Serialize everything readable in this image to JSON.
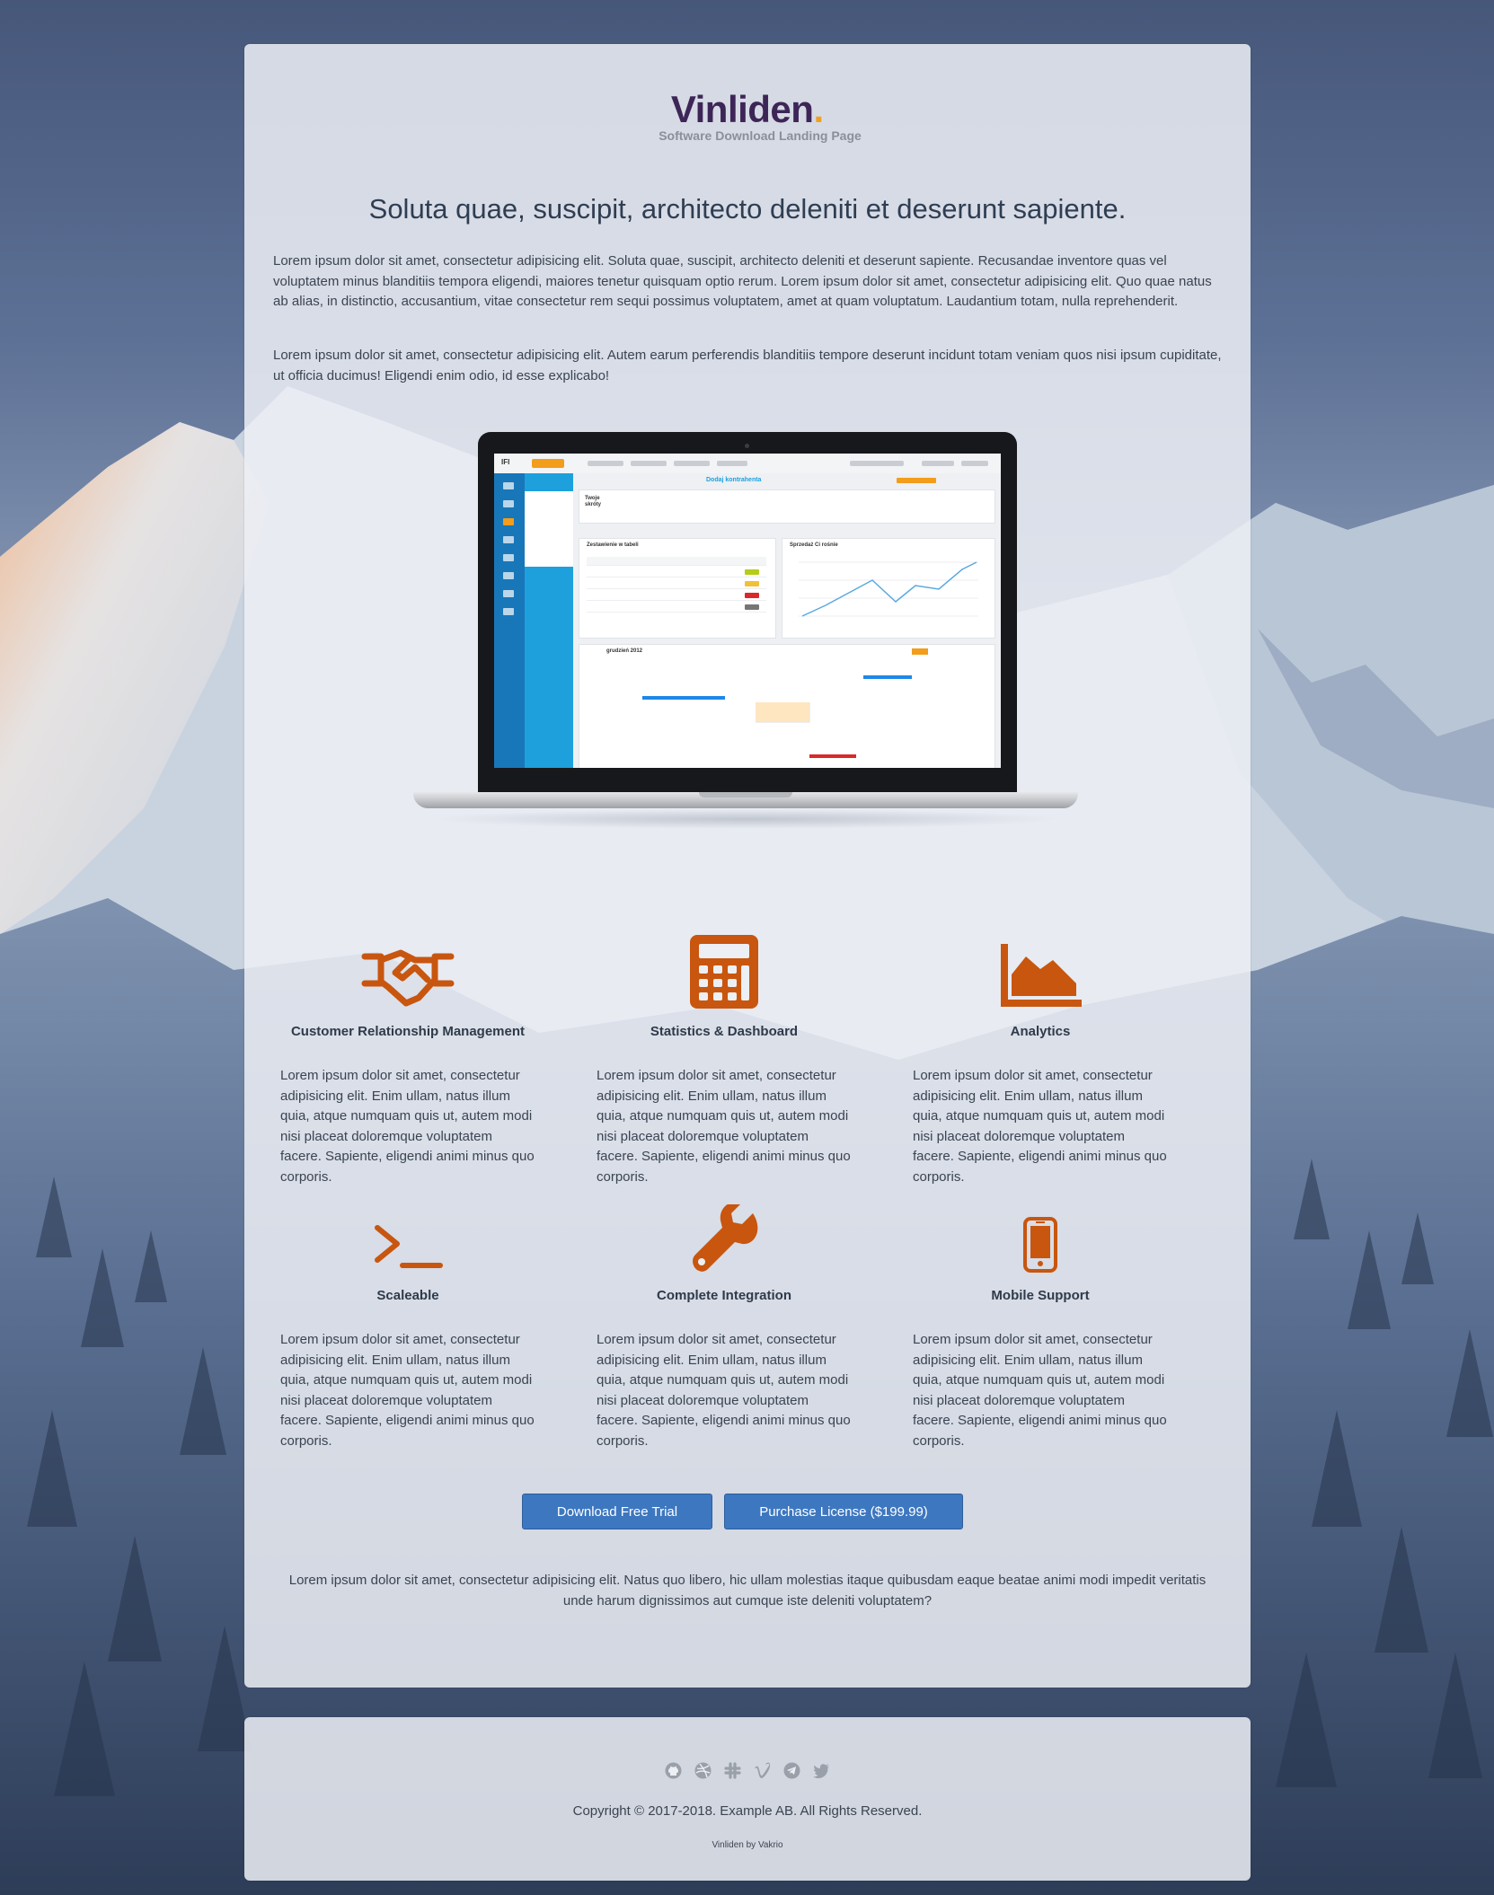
{
  "brand": {
    "name": "Vinliden",
    "dot": ".",
    "tagline": "Software Download Landing Page",
    "primary_color": "#3d2657",
    "accent_color": "#f0a020"
  },
  "hero": {
    "headline": "Soluta quae, suscipit, architecto deleniti et deserunt sapiente.",
    "paragraph1": "Lorem ipsum dolor sit amet, consectetur adipisicing elit. Soluta quae, suscipit, architecto deleniti et deserunt sapiente. Recusandae inventore quas vel voluptatem minus blanditiis tempora eligendi, maiores tenetur quisquam optio rerum. Lorem ipsum dolor sit amet, consectetur adipisicing elit. Quo quae natus ab alias, in distinctio, accusantium, vitae consectetur rem sequi possimus voluptatem, amet at quam voluptatum. Laudantium totam, nulla reprehenderit.",
    "paragraph2": "Lorem ipsum dolor sit amet, consectetur adipisicing elit. Autem earum perferendis blanditiis tempore deserunt incidunt totam veniam quos nisi ipsum cupiditate, ut officia ducimus! Eligendi enim odio, id esse explicabo!"
  },
  "screenshot": {
    "page_title": "Dodaj kontrahenta",
    "panel1_title": "Zestawienie w tabeli",
    "panel2_title": "Sprzedaż Ci rośnie",
    "calendar_title": "grudzień 2012",
    "box_title": "Twoje skróty"
  },
  "features": [
    {
      "icon": "handshake-icon",
      "title": "Customer Relationship Management",
      "text": "Lorem ipsum dolor sit amet, consectetur adipisicing elit. Enim ullam, natus illum quia, atque numquam quis ut, autem modi nisi placeat doloremque voluptatem facere. Sapiente, eligendi animi minus quo corporis."
    },
    {
      "icon": "calculator-icon",
      "title": "Statistics & Dashboard",
      "text": "Lorem ipsum dolor sit amet, consectetur adipisicing elit. Enim ullam, natus illum quia, atque numquam quis ut, autem modi nisi placeat doloremque voluptatem facere. Sapiente, eligendi animi minus quo corporis."
    },
    {
      "icon": "area-chart-icon",
      "title": "Analytics",
      "text": "Lorem ipsum dolor sit amet, consectetur adipisicing elit. Enim ullam, natus illum quia, atque numquam quis ut, autem modi nisi placeat doloremque voluptatem facere. Sapiente, eligendi animi minus quo corporis."
    },
    {
      "icon": "terminal-icon",
      "title": "Scaleable",
      "text": "Lorem ipsum dolor sit amet, consectetur adipisicing elit. Enim ullam, natus illum quia, atque numquam quis ut, autem modi nisi placeat doloremque voluptatem facere. Sapiente, eligendi animi minus quo corporis."
    },
    {
      "icon": "wrench-icon",
      "title": "Complete Integration",
      "text": "Lorem ipsum dolor sit amet, consectetur adipisicing elit. Enim ullam, natus illum quia, atque numquam quis ut, autem modi nisi placeat doloremque voluptatem facere. Sapiente, eligendi animi minus quo corporis."
    },
    {
      "icon": "mobile-phone-icon",
      "title": "Mobile Support",
      "text": "Lorem ipsum dolor sit amet, consectetur adipisicing elit. Enim ullam, natus illum quia, atque numquam quis ut, autem modi nisi placeat doloremque voluptatem facere. Sapiente, eligendi animi minus quo corporis."
    }
  ],
  "icon_color": "#c8560f",
  "cta": {
    "trial_label": "Download Free Trial",
    "buy_label": "Purchase License ($199.99)",
    "button_color": "#3d77c0"
  },
  "closing_text": "Lorem ipsum dolor sit amet, consectetur adipisicing elit. Natus quo libero, hic ullam molestias itaque quibusdam eaque beatae animi modi impedit veritatis unde harum dignissimos aut cumque iste deleniti voluptatem?",
  "footer": {
    "social": [
      "github-icon",
      "dribbble-icon",
      "slack-icon",
      "vimeo-icon",
      "telegram-icon",
      "twitter-icon"
    ],
    "copyright": "Copyright © 2017-2018. Example AB. All Rights Reserved.",
    "credit": "Vinliden by Vakrio"
  }
}
